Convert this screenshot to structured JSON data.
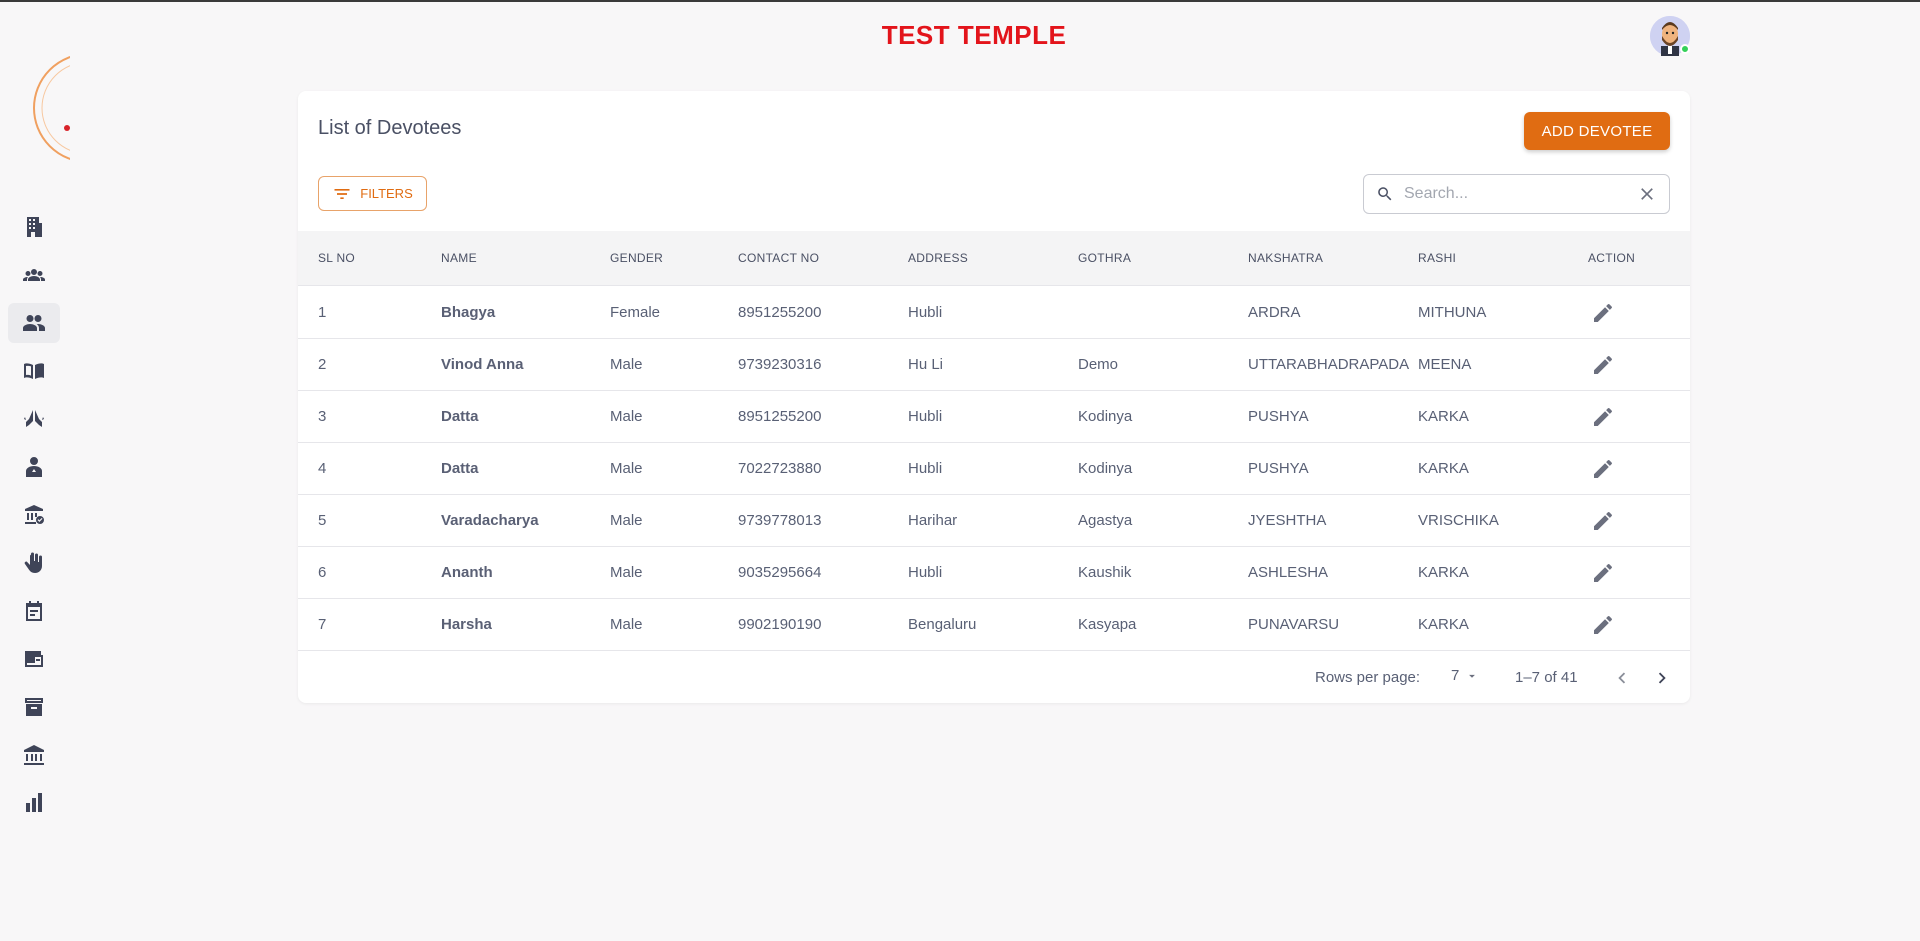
{
  "header": {
    "app_title": "TEST TEMPLE"
  },
  "sidebar": {
    "items": [
      {
        "icon": "building-icon"
      },
      {
        "icon": "group-icon"
      },
      {
        "icon": "devotees-icon",
        "active": true
      },
      {
        "icon": "book-icon"
      },
      {
        "icon": "praying-hands-icon"
      },
      {
        "icon": "priest-icon"
      },
      {
        "icon": "temple-verified-icon"
      },
      {
        "icon": "hand-icon"
      },
      {
        "icon": "calendar-icon"
      },
      {
        "icon": "wallet-icon"
      },
      {
        "icon": "archive-icon"
      },
      {
        "icon": "bank-icon"
      },
      {
        "icon": "bar-chart-icon"
      }
    ]
  },
  "page": {
    "title": "List of Devotees",
    "add_button": "ADD DEVOTEE",
    "filters_button": "FILTERS",
    "search_placeholder": "Search..."
  },
  "table": {
    "columns": [
      "SL NO",
      "NAME",
      "GENDER",
      "CONTACT NO",
      "ADDRESS",
      "GOTHRA",
      "NAKSHATRA",
      "RASHI",
      "ACTION"
    ],
    "rows": [
      {
        "sl": "1",
        "name": "Bhagya",
        "gender": "Female",
        "contact": "8951255200",
        "address": "Hubli",
        "gothra": "",
        "nakshatra": "ARDRA",
        "rashi": "MITHUNA"
      },
      {
        "sl": "2",
        "name": "Vinod Anna",
        "gender": "Male",
        "contact": "9739230316",
        "address": "Hu Li",
        "gothra": "Demo",
        "nakshatra": "UTTARABHADRAPADA",
        "rashi": "MEENA"
      },
      {
        "sl": "3",
        "name": "Datta",
        "gender": "Male",
        "contact": "8951255200",
        "address": "Hubli",
        "gothra": "Kodinya",
        "nakshatra": "PUSHYA",
        "rashi": "KARKA"
      },
      {
        "sl": "4",
        "name": "Datta",
        "gender": "Male",
        "contact": "7022723880",
        "address": "Hubli",
        "gothra": "Kodinya",
        "nakshatra": "PUSHYA",
        "rashi": "KARKA"
      },
      {
        "sl": "5",
        "name": "Varadacharya",
        "gender": "Male",
        "contact": "9739778013",
        "address": "Harihar",
        "gothra": "Agastya",
        "nakshatra": "JYESHTHA",
        "rashi": "VRISCHIKA"
      },
      {
        "sl": "6",
        "name": "Ananth",
        "gender": "Male",
        "contact": "9035295664",
        "address": "Hubli",
        "gothra": "Kaushik",
        "nakshatra": "ASHLESHA",
        "rashi": "KARKA"
      },
      {
        "sl": "7",
        "name": "Harsha",
        "gender": "Male",
        "contact": "9902190190",
        "address": "Bengaluru",
        "gothra": "Kasyapa",
        "nakshatra": "PUNAVARSU",
        "rashi": "KARKA"
      }
    ]
  },
  "pagination": {
    "rows_per_page_label": "Rows per page:",
    "rows_per_page": "7",
    "range": "1–7 of 41"
  },
  "colors": {
    "brand": "#e06c12",
    "title": "#e3141b"
  }
}
